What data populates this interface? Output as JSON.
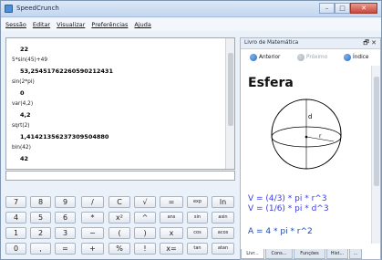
{
  "window": {
    "title": "SpeedCrunch",
    "controls": [
      "–",
      "□",
      "✕"
    ]
  },
  "menu": [
    "Sessão",
    "Editar",
    "Visualizar",
    "Preferências",
    "Ajuda"
  ],
  "history": [
    {
      "expr": "",
      "result": "22"
    },
    {
      "expr": "5*sin(45)+49",
      "result": "53,25451762260590212431"
    },
    {
      "expr": "sin(2*pi)",
      "result": "0"
    },
    {
      "expr": "var(4,2)",
      "result": "4,2"
    },
    {
      "expr": "sqrt(2)",
      "result": "1,41421356237309504880"
    },
    {
      "expr": "bin(42)",
      "result": "42"
    }
  ],
  "input": {
    "value": ""
  },
  "keypad": [
    [
      "7",
      "8",
      "9",
      "/",
      "C",
      "√",
      "=",
      "exp",
      "ln"
    ],
    [
      "4",
      "5",
      "6",
      "*",
      "x²",
      "^",
      "ans",
      "sin",
      "asin"
    ],
    [
      "1",
      "2",
      "3",
      "−",
      "(",
      ")",
      "x",
      "cos",
      "acos"
    ],
    [
      "0",
      ",",
      "=",
      "+",
      "%",
      "!",
      "x=",
      "tan",
      "atan"
    ]
  ],
  "panel": {
    "title": "Livro de Matemática",
    "controls": "🗗 ✕",
    "nav": {
      "back": "Anterior",
      "next": "Próximo",
      "index": "Índice"
    },
    "heading": "Esfera",
    "formulas": [
      "V = (4/3) * pi * r^3",
      "V = (1/6) * pi * d^3",
      "A = 4 * pi * r^2"
    ],
    "diagram_labels": {
      "d": "d",
      "r": "r"
    },
    "tabs": [
      "Livr...",
      "Cons...",
      "Funções",
      "Hist...",
      "..."
    ]
  }
}
